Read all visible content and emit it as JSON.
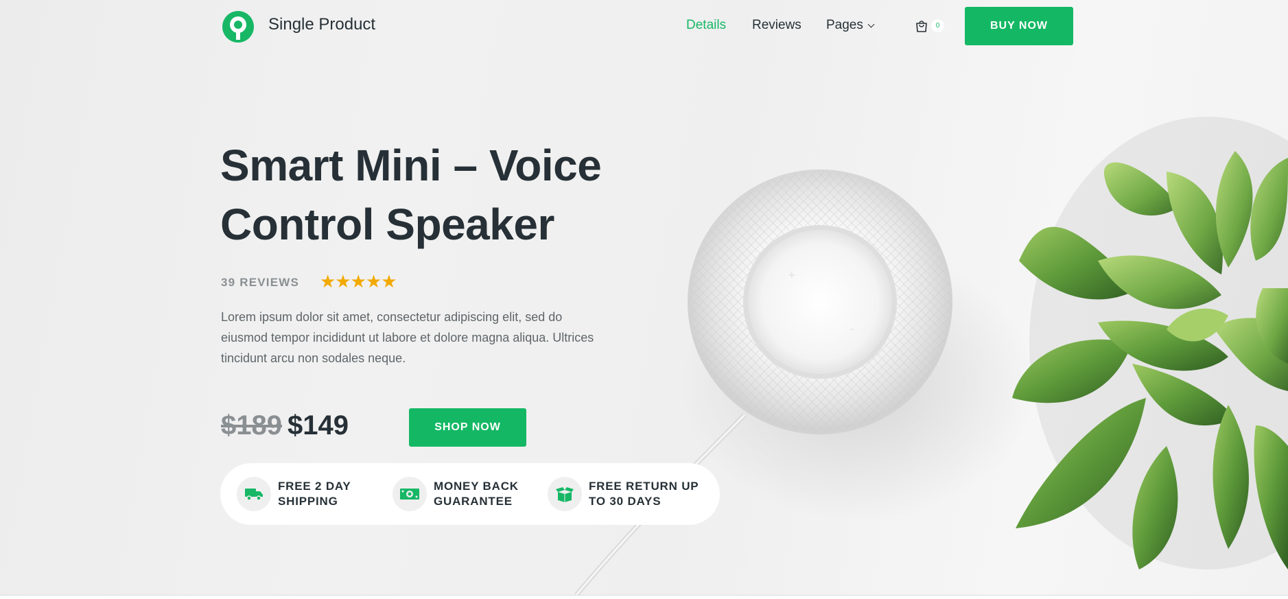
{
  "header": {
    "brand": "Single Product",
    "nav": [
      {
        "label": "Details",
        "active": true
      },
      {
        "label": "Reviews",
        "active": false
      },
      {
        "label": "Pages",
        "active": false
      }
    ],
    "cart_count": "0",
    "buy_label": "BUY NOW"
  },
  "hero": {
    "title": "Smart Mini – Voice Control Speaker",
    "reviews_label": "39 REVIEWS",
    "stars": "★★★★★",
    "rating": 5,
    "description": "Lorem ipsum dolor sit amet, consectetur adipiscing elit, sed do eiusmod tempor incididunt ut labore et dolore magna aliqua. Ultrices tincidunt arcu non sodales neque.",
    "old_price": "$189",
    "price": "$149",
    "shop_label": "SHOP NOW"
  },
  "features": [
    {
      "icon": "truck-icon",
      "text": "FREE 2 DAY SHIPPING"
    },
    {
      "icon": "money-icon",
      "text": "MONEY BACK GUARANTEE"
    },
    {
      "icon": "box-icon",
      "text": "FREE RETURN UP TO 30 DAYS"
    }
  ],
  "colors": {
    "accent": "#14b864",
    "heading": "#263036",
    "muted": "#8a8f92",
    "star": "#f2a900"
  }
}
